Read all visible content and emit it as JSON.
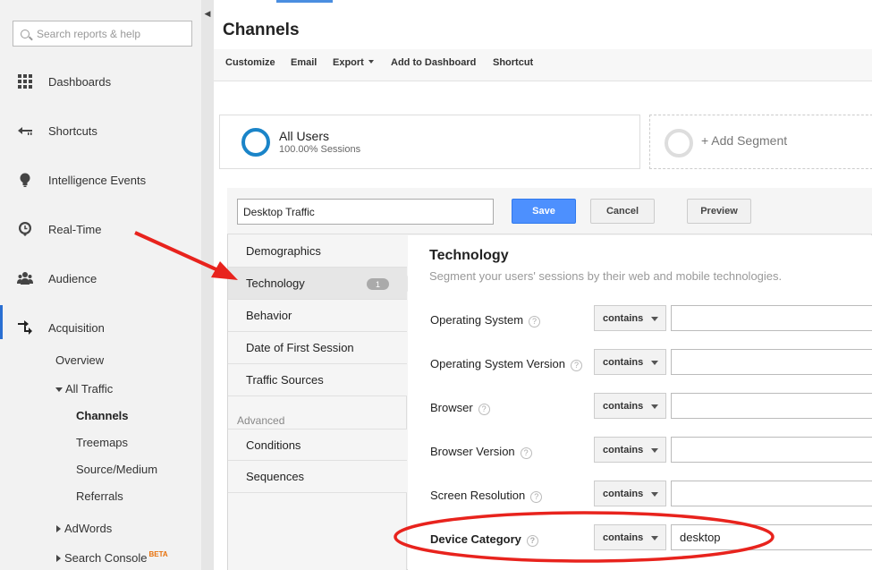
{
  "sidebar": {
    "search_placeholder": "Search reports & help",
    "items": [
      {
        "label": "Dashboards",
        "icon": "grid-icon"
      },
      {
        "label": "Shortcuts",
        "icon": "shortcut-arrow-icon"
      },
      {
        "label": "Intelligence Events",
        "icon": "lightbulb-icon"
      },
      {
        "label": "Real-Time",
        "icon": "clock-icon"
      },
      {
        "label": "Audience",
        "icon": "people-icon"
      },
      {
        "label": "Acquisition",
        "icon": "acquisition-arrows-icon"
      }
    ],
    "sub_items": {
      "overview": "Overview",
      "all_traffic": "All Traffic",
      "channels": "Channels",
      "treemaps": "Treemaps",
      "source_medium": "Source/Medium",
      "referrals": "Referrals",
      "adwords": "AdWords",
      "search_console": "Search Console",
      "beta": "BETA"
    }
  },
  "header": {
    "title": "Channels",
    "toolbar": [
      "Customize",
      "Email",
      "Export",
      "Add to Dashboard",
      "Shortcut"
    ]
  },
  "segments": {
    "active_name": "All Users",
    "active_sub": "100.00% Sessions",
    "add_label": "+ Add Segment"
  },
  "editor": {
    "segment_name_value": "Desktop Traffic",
    "save": "Save",
    "cancel": "Cancel",
    "preview": "Preview",
    "categories": [
      "Demographics",
      "Technology",
      "Behavior",
      "Date of First Session",
      "Traffic Sources"
    ],
    "technology_badge": "1",
    "advanced_label": "Advanced",
    "advanced": [
      "Conditions",
      "Sequences"
    ],
    "section_title": "Technology",
    "section_desc": "Segment your users' sessions by their web and mobile technologies.",
    "fields": [
      {
        "label": "Operating System",
        "op": "contains",
        "value": ""
      },
      {
        "label": "Operating System Version",
        "op": "contains",
        "value": ""
      },
      {
        "label": "Browser",
        "op": "contains",
        "value": ""
      },
      {
        "label": "Browser Version",
        "op": "contains",
        "value": ""
      },
      {
        "label": "Screen Resolution",
        "op": "contains",
        "value": ""
      },
      {
        "label": "Device Category",
        "op": "contains",
        "value": "desktop"
      }
    ],
    "help_glyph": "?"
  },
  "colors": {
    "accent_blue": "#4d90fe",
    "annotation_red": "#e8231d",
    "segment_ring": "#1a84c8"
  }
}
